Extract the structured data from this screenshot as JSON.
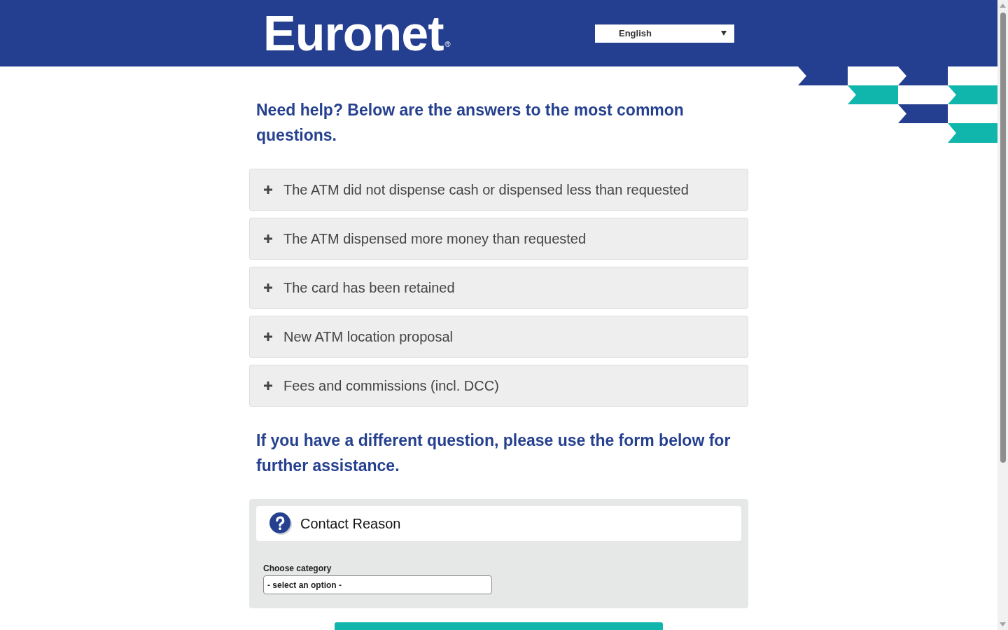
{
  "header": {
    "logo": {
      "text": "Euronet",
      "mark": "®"
    },
    "language_select": {
      "value": "English"
    }
  },
  "faq": {
    "heading": "Need help? Below are the answers to the most common questions.",
    "items": [
      {
        "question": "The ATM did not dispense cash or dispensed less than requested",
        "expanded": false
      },
      {
        "question": "The ATM dispensed more money than requested",
        "expanded": false
      },
      {
        "question": "The card has been retained",
        "expanded": false
      },
      {
        "question": "New ATM location proposal",
        "expanded": false
      },
      {
        "question": "Fees and commissions (incl. DCC)",
        "expanded": false
      }
    ]
  },
  "contact": {
    "heading": "If you have a different question, please use the form below for further assistance.",
    "form": {
      "title": "Contact Reason",
      "fields": [
        {
          "label": "Choose category",
          "value": "- select an option -"
        }
      ]
    }
  }
}
